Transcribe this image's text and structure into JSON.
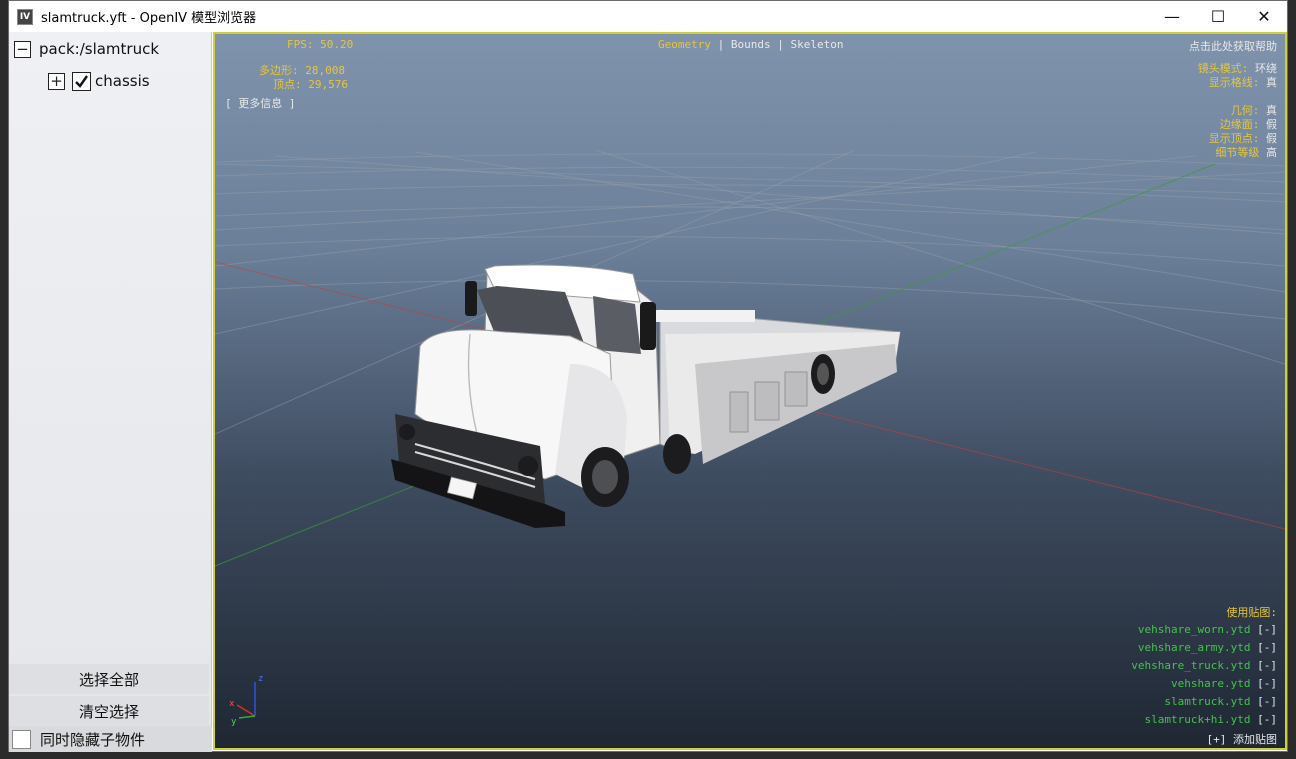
{
  "window": {
    "icon_text": "IV",
    "title": "slamtruck.yft - OpenIV 模型浏览器",
    "minimize": "—",
    "maximize": "☐",
    "close": "✕"
  },
  "tree": {
    "root_expander": "−",
    "root_label": "pack:/slamtruck",
    "child_expander": "+",
    "child_label": "chassis"
  },
  "buttons": {
    "select_all": "选择全部",
    "clear_selection": "清空选择",
    "hide_children": "同时隐藏子物件"
  },
  "stats": {
    "fps_label": "FPS:",
    "fps_value": "50.20",
    "poly_label": "多边形:",
    "poly_value": "28,008",
    "vert_label": "顶点:",
    "vert_value": "29,576",
    "more_info": "[ 更多信息 ]"
  },
  "view_tabs": {
    "geometry": "Geometry",
    "sep1": "|",
    "bounds": "Bounds",
    "sep2": "|",
    "skeleton": "Skeleton"
  },
  "help_text": "点击此处获取帮助",
  "settings": [
    {
      "label": "镜头模式:",
      "value": "环绕"
    },
    {
      "label": "显示格线:",
      "value": "真"
    },
    {
      "label": "几何:",
      "value": "真"
    },
    {
      "label": "边缘面:",
      "value": "假"
    },
    {
      "label": "显示顶点:",
      "value": "假"
    },
    {
      "label": "细节等级",
      "value": "高"
    }
  ],
  "textures": {
    "header": "使用贴图:",
    "items": [
      {
        "name": "vehshare_worn.ytd",
        "action": "[-]"
      },
      {
        "name": "vehshare_army.ytd",
        "action": "[-]"
      },
      {
        "name": "vehshare_truck.ytd",
        "action": "[-]"
      },
      {
        "name": "vehshare.ytd",
        "action": "[-]"
      },
      {
        "name": "slamtruck.ytd",
        "action": "[-]"
      },
      {
        "name": "slamtruck+hi.ytd",
        "action": "[-]"
      }
    ],
    "add_action": "[+]",
    "add_label": "添加贴图"
  },
  "axis": {
    "x": "x",
    "y": "y",
    "z": "z"
  },
  "colors": {
    "osd_yellow": "#e6c63a",
    "osd_green": "#43c44a",
    "viewport_border": "#cfcf3a",
    "grid_line": "#9aa0a8",
    "axis_red": "#c04040",
    "axis_green": "#3a9a3a"
  }
}
